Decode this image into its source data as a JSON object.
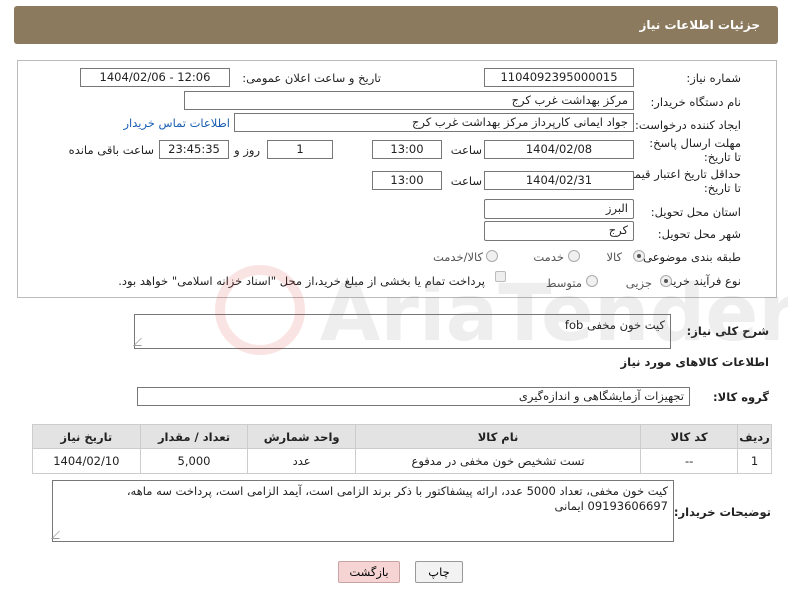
{
  "header": {
    "title": "جزئیات اطلاعات نیاز"
  },
  "form": {
    "need_number_label": "شماره نیاز:",
    "need_number": "1104092395000015",
    "announce_label": "تاریخ و ساعت اعلان عمومی:",
    "announce_value": "1404/02/06 - 12:06",
    "buyer_org_label": "نام دستگاه خریدار:",
    "buyer_org": "مرکز بهداشت غرب کرج",
    "requester_label": "ایجاد کننده درخواست:",
    "requester": "جواد ایمانی کارپرداز مرکز بهداشت غرب کرج",
    "contact_link": "اطلاعات تماس خریدار",
    "reply_deadline_label": "مهلت ارسال پاسخ: تا تاریخ:",
    "reply_date": "1404/02/08",
    "time_label": "ساعت",
    "reply_time": "13:00",
    "days_value": "1",
    "days_label": "روز و",
    "remaining_time": "23:45:35",
    "remaining_label": "ساعت باقی مانده",
    "validity_label": "حداقل تاریخ اعتبار قیمت: تا تاریخ:",
    "validity_date": "1404/02/31",
    "validity_time_label": "ساعت",
    "validity_time": "13:00",
    "province_label": "استان محل تحویل:",
    "province": "البرز",
    "city_label": "شهر محل تحویل:",
    "city": "کرج",
    "category_label": "طبقه بندی موضوعی:",
    "category_options": [
      "کالا",
      "خدمت",
      "کالا/خدمت"
    ],
    "process_label": "نوع فرآیند خرید :",
    "process_options": [
      "جزیی",
      "متوسط"
    ],
    "payment_note": "پرداخت تمام یا بخشی از مبلغ خرید،از محل \"اسناد خزانه اسلامی\" خواهد بود."
  },
  "summary": {
    "label": "شرح کلی نیاز:",
    "value": "کیت خون مخفی fob"
  },
  "goods": {
    "section_title": "اطلاعات کالاهای مورد نیاز",
    "group_label": "گروه کالا:",
    "group_value": "تجهیزات آزمایشگاهی و اندازه‌گیری",
    "columns": [
      "ردیف",
      "کد کالا",
      "نام کالا",
      "واحد شمارش",
      "تعداد / مقدار",
      "تاریخ نیاز"
    ],
    "rows": [
      {
        "row": "1",
        "code": "--",
        "name": "تست تشخیص خون مخفی در مدفوع",
        "unit": "عدد",
        "qty": "5,000",
        "date": "1404/02/10"
      }
    ]
  },
  "buyer_notes": {
    "label": "توضیحات خریدار:",
    "line1": "کیت خون مخفی، تعداد 5000 عدد، ارائه پیشفاکتور با ذکر برند الزامی است، آیمد الزامی است، پرداخت سه ماهه،",
    "line2": "09193606697 ایمانی"
  },
  "buttons": {
    "print": "چاپ",
    "back": "بازگشت"
  },
  "watermark": "AriaTender.neT",
  "colors": {
    "header": "#8b7a5e",
    "link": "#1a5fb4",
    "table_header": "#e3e3e3",
    "back_button": "#f6d4d4"
  }
}
